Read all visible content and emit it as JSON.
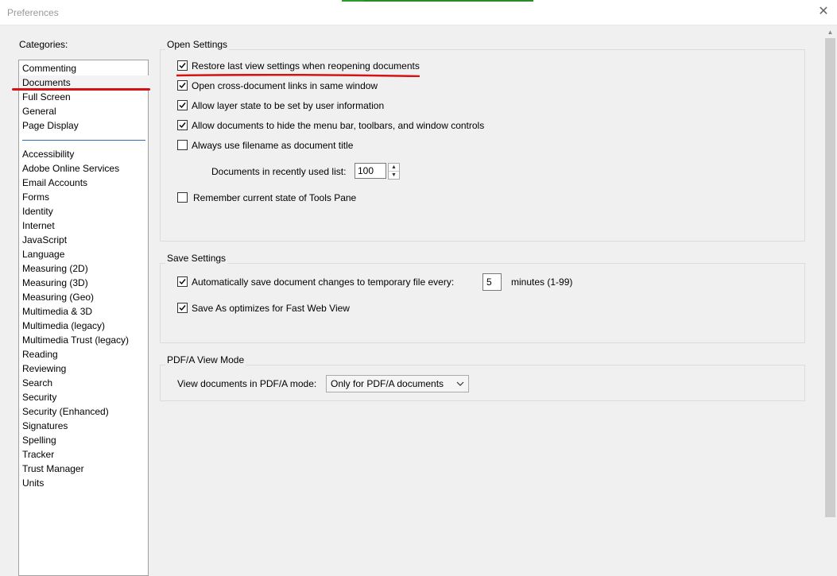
{
  "window": {
    "title": "Preferences"
  },
  "categories": {
    "label": "Categories:",
    "primary": [
      "Commenting",
      "Documents",
      "Full Screen",
      "General",
      "Page Display"
    ],
    "secondary": [
      "Accessibility",
      "Adobe Online Services",
      "Email Accounts",
      "Forms",
      "Identity",
      "Internet",
      "JavaScript",
      "Language",
      "Measuring (2D)",
      "Measuring (3D)",
      "Measuring (Geo)",
      "Multimedia & 3D",
      "Multimedia (legacy)",
      "Multimedia Trust (legacy)",
      "Reading",
      "Reviewing",
      "Search",
      "Security",
      "Security (Enhanced)",
      "Signatures",
      "Spelling",
      "Tracker",
      "Trust Manager",
      "Units"
    ],
    "selected": "Documents"
  },
  "open_settings": {
    "title": "Open Settings",
    "restore_view": {
      "label": "Restore last view settings when reopening documents",
      "checked": true
    },
    "cross_doc_links": {
      "label": "Open cross-document links in same window",
      "checked": true
    },
    "layer_state": {
      "label": "Allow layer state to be set by user information",
      "checked": true
    },
    "hide_menu": {
      "label": "Allow documents to hide the menu bar, toolbars, and window controls",
      "checked": true
    },
    "filename_title": {
      "label": "Always use filename as document title",
      "checked": false
    },
    "recent_list": {
      "label": "Documents in recently used list:",
      "value": "100"
    },
    "tools_pane": {
      "label": "Remember current state of Tools Pane",
      "checked": false
    }
  },
  "save_settings": {
    "title": "Save Settings",
    "autosave": {
      "label": "Automatically save document changes to temporary file every:",
      "checked": true,
      "value": "5",
      "unit": "minutes (1-99)"
    },
    "fast_web": {
      "label": "Save As optimizes for Fast Web View",
      "checked": true
    }
  },
  "pdfa": {
    "title": "PDF/A View Mode",
    "label": "View documents in PDF/A mode:",
    "selected": "Only for PDF/A documents"
  },
  "colors": {
    "annotation_red": "#d41414",
    "separator_blue": "#2e6db4"
  }
}
